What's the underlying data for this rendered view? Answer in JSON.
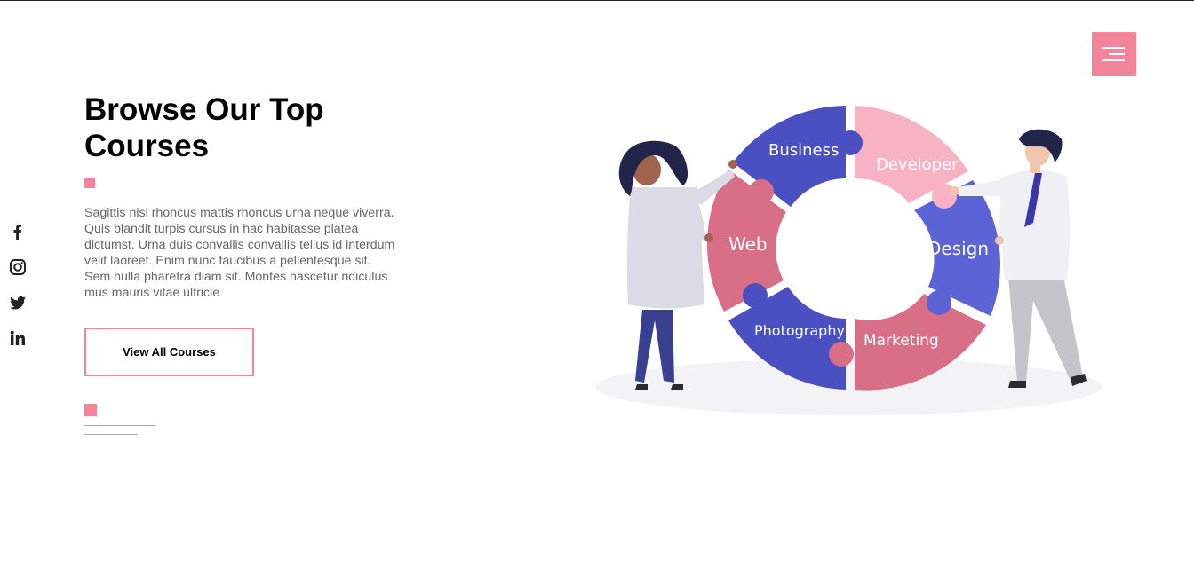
{
  "header": {
    "menu_icon": "hamburger-menu-icon",
    "accent_color": "#f4849a"
  },
  "social": [
    {
      "name": "facebook",
      "icon": "facebook-icon"
    },
    {
      "name": "instagram",
      "icon": "instagram-icon"
    },
    {
      "name": "twitter",
      "icon": "twitter-icon"
    },
    {
      "name": "linkedin",
      "icon": "linkedin-icon"
    }
  ],
  "hero": {
    "title_line1": "Browse Our Top",
    "title_line2": "Courses",
    "description": "Sagittis nisl rhoncus mattis rhoncus urna neque viverra. Quis blandit turpis cursus in hac habitasse platea dictumst. Urna duis convallis convallis tellus id interdum velit laoreet. Enim nunc faucibus a pellentesque sit. Sem nulla pharetra diam sit. Montes nascetur ridiculus mus mauris vitae ultricie",
    "cta_label": "View All Courses"
  },
  "illustration": {
    "segments": [
      {
        "label": "Business",
        "color": "#4a4fc1"
      },
      {
        "label": "Developer",
        "color": "#f7b3c4"
      },
      {
        "label": "Design",
        "color": "#5c63d6"
      },
      {
        "label": "Marketing",
        "color": "#d96f86"
      },
      {
        "label": "Photography",
        "color": "#4a4fc1"
      },
      {
        "label": "Web",
        "color": "#d96f86"
      }
    ]
  }
}
